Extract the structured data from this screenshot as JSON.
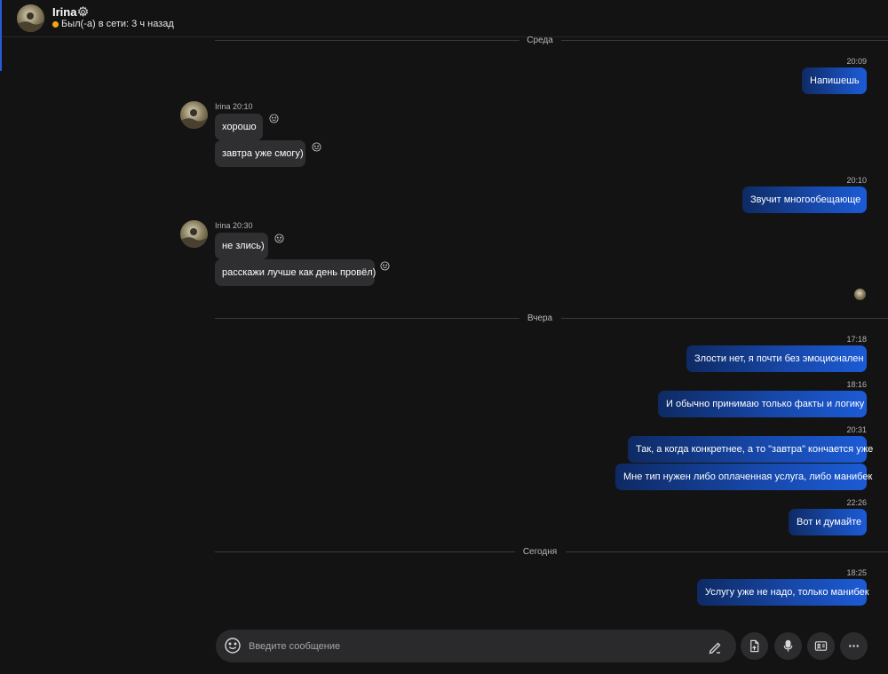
{
  "header": {
    "contact_name": "Irina",
    "presence_text": "Был(-а) в сети: 3 ч назад",
    "presence_color": "#f7a414",
    "icons": [
      "settings-icon"
    ]
  },
  "date_separators": [
    "Среда",
    "Вчера",
    "Сегодня"
  ],
  "messages": {
    "m1_time": "20:09",
    "m1_text": "Напишешь",
    "r1_author": "Irina",
    "r1_time": "20:10",
    "r1_text1": "хорошо",
    "r1_text2": "завтра уже смогу)",
    "m2_time": "20:10",
    "m2_text": "Звучит многообещающе",
    "r2_author": "Irina",
    "r2_time": "20:30",
    "r2_text1": "не злись)",
    "r2_text2": "расскажи лучше как день провёл)",
    "m3_time": "17:18",
    "m3_text": "Злости нет, я почти без эмоционален",
    "m4_time": "18:16",
    "m4_text": "И обычно принимаю только факты и логику",
    "m5_time": "20:31",
    "m5_text1": "Так, а когда конкретнее, а то \"завтра\" кончается уже",
    "m5_text2": "Мне тип нужен либо оплаченная услуга, либо манибек",
    "m6_time": "22:26",
    "m6_text": "Вот и думайте",
    "m7_time": "18:25",
    "m7_text": "Услугу уже не надо, только манибек"
  },
  "composer": {
    "placeholder": "Введите сообщение",
    "buttons": [
      "emoji-icon",
      "pen-icon",
      "file-icon",
      "mic-icon",
      "contact-card-icon",
      "more-icon"
    ]
  },
  "colors": {
    "background": "#131314",
    "incoming_bubble": "#2f2f31",
    "outgoing_gradient_start": "#0e2a63",
    "outgoing_gradient_end": "#1c5bd6",
    "accent": "#2b59d9"
  }
}
